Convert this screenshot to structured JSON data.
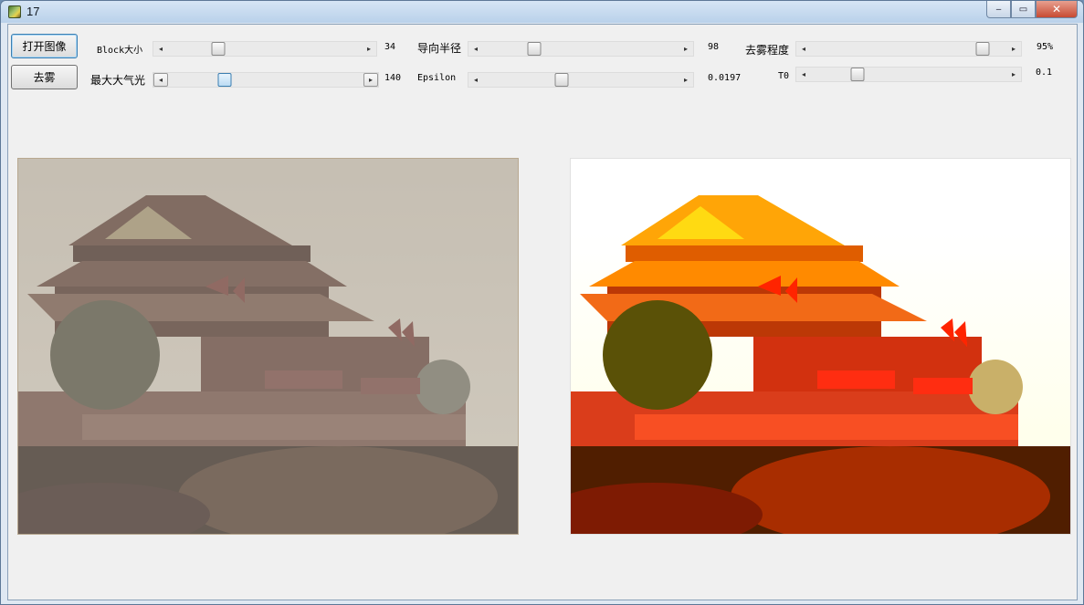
{
  "window": {
    "title": "17",
    "controls": {
      "minimize": "‒",
      "maximize": "▭",
      "close": "✕"
    }
  },
  "toolbar": {
    "open_image_label": "打开图像",
    "dehaze_label": "去雾"
  },
  "params": {
    "block_size": {
      "label": "Block大小",
      "value_text": "34",
      "level": 0.26
    },
    "max_atmospheric_light": {
      "label": "最大大气光",
      "value_text": "140",
      "level": 0.29
    },
    "guided_radius": {
      "label": "导向半径",
      "value_text": "98",
      "level": 0.26
    },
    "epsilon": {
      "label": "Epsilon",
      "value_text": "0.0197",
      "level": 0.4
    },
    "dehaze_degree": {
      "label": "去雾程度",
      "value_text": "95%",
      "level": 0.88
    },
    "t0": {
      "label": "T0",
      "value_text": "0.1",
      "level": 0.24
    }
  },
  "arrows": {
    "left": "◂",
    "right": "▸"
  },
  "images": {
    "original_name": "original-hazy-image",
    "result_name": "dehazed-result-image"
  },
  "colors": {
    "window_frame": "#a9c4e0",
    "client_bg": "#f0f0f0",
    "accent": "#3c7fb1"
  }
}
